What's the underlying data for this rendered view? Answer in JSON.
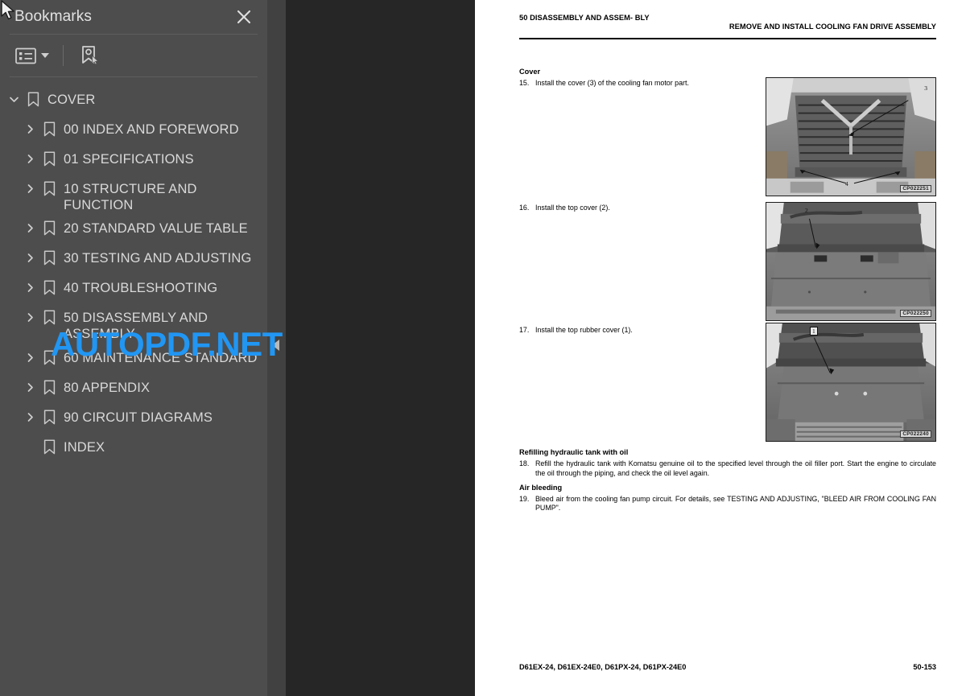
{
  "sidebar": {
    "title": "Bookmarks",
    "close_icon": "close-icon",
    "toolbar": {
      "options_icon": "bookmark-options-list-icon",
      "options_caret": "chevron-down-icon",
      "new_bookmark_icon": "new-bookmark-icon"
    },
    "bookmarks": [
      {
        "label": "COVER",
        "level": 0,
        "expanded": true,
        "has_children": true
      },
      {
        "label": "00 INDEX AND FOREWORD",
        "level": 1,
        "expanded": false,
        "has_children": true
      },
      {
        "label": "01 SPECIFICATIONS",
        "level": 1,
        "expanded": false,
        "has_children": true
      },
      {
        "label": "10 STRUCTURE AND FUNCTION",
        "level": 1,
        "expanded": false,
        "has_children": true
      },
      {
        "label": "20 STANDARD VALUE TABLE",
        "level": 1,
        "expanded": false,
        "has_children": true
      },
      {
        "label": "30 TESTING AND ADJUSTING",
        "level": 1,
        "expanded": false,
        "has_children": true
      },
      {
        "label": "40 TROUBLESHOOTING",
        "level": 1,
        "expanded": false,
        "has_children": true
      },
      {
        "label": "50 DISASSEMBLY AND\nASSEMBLY",
        "level": 1,
        "expanded": false,
        "has_children": true
      },
      {
        "label": "60 MAINTENANCE STANDARD",
        "level": 1,
        "expanded": false,
        "has_children": true
      },
      {
        "label": "80 APPENDIX",
        "level": 1,
        "expanded": false,
        "has_children": true
      },
      {
        "label": "90 CIRCUIT DIAGRAMS",
        "level": 1,
        "expanded": false,
        "has_children": true
      },
      {
        "label": "INDEX",
        "level": 1,
        "expanded": false,
        "has_children": false
      }
    ]
  },
  "divider": {
    "collapse_icon": "collapse-panel-arrow-icon"
  },
  "watermark": {
    "text": "AUTOPDF.NET",
    "color": "#2196f3"
  },
  "document": {
    "header": {
      "left": "50 DISASSEMBLY AND ASSEM-\nBLY",
      "right": "REMOVE AND INSTALL COOLING FAN DRIVE ASSEMBLY"
    },
    "sections": [
      {
        "heading": "Cover",
        "steps": [
          {
            "num": "15.",
            "text": "Install the cover (3) of the cooling fan motor part."
          }
        ]
      },
      {
        "heading": "",
        "steps": [
          {
            "num": "16.",
            "text": "Install the top cover (2)."
          }
        ]
      },
      {
        "heading": "",
        "steps": [
          {
            "num": "17.",
            "text": "Install the top rubber cover (1)."
          }
        ]
      },
      {
        "heading": "Refilling hydraulic tank with oil",
        "steps": [
          {
            "num": "18.",
            "text": "Refill the hydraulic tank with Komatsu genuine oil to the specified level through the oil filler port. Start the engine to circulate the oil through the piping, and check the oil level again."
          }
        ]
      },
      {
        "heading": "Air bleeding",
        "steps": [
          {
            "num": "19.",
            "text": "Bleed air from the cooling fan pump circuit. For details, see TESTING AND ADJUSTING, \"BLEED AIR FROM COOLING FAN PUMP\"."
          }
        ]
      }
    ],
    "figures": [
      {
        "code": "CP022251",
        "callouts": [
          "3",
          "4"
        ],
        "alt": "cooling fan grille cover photo"
      },
      {
        "code": "CP022250",
        "callouts": [
          "2"
        ],
        "alt": "top cover photo"
      },
      {
        "code": "CP022240",
        "callouts": [
          "1"
        ],
        "alt": "top rubber cover photo"
      }
    ],
    "footer": {
      "left": "D61EX-24, D61EX-24E0, D61PX-24, D61PX-24E0",
      "right": "50-153"
    }
  }
}
